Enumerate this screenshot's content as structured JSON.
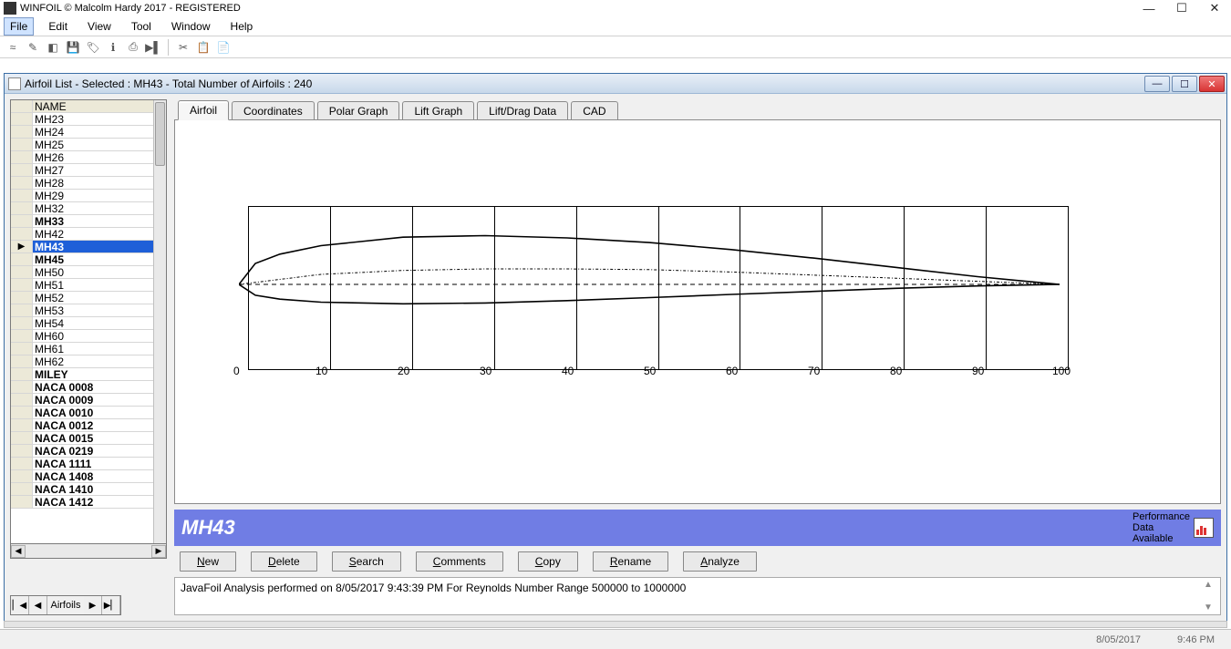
{
  "titlebar": {
    "text": "WINFOIL © Malcolm Hardy 2017 - REGISTERED"
  },
  "window_controls": {
    "min": "—",
    "max": "☐",
    "close": "✕"
  },
  "menu": [
    "File",
    "Edit",
    "View",
    "Tool",
    "Window",
    "Help"
  ],
  "menu_active_idx": 0,
  "toolbar_icons": [
    "≈",
    "✎",
    "◧",
    "💾",
    "🏷",
    "ℹ",
    "⎙",
    "▶▌",
    "│",
    "✂",
    "📋",
    "📄"
  ],
  "subwindow": {
    "title": "Airfoil List - Selected : MH43 - Total Number of Airfoils : 240",
    "min": "—",
    "max": "☐",
    "close": "✕"
  },
  "list": {
    "header": "NAME",
    "items": [
      {
        "n": "MH23",
        "b": false
      },
      {
        "n": "MH24",
        "b": false
      },
      {
        "n": "MH25",
        "b": false
      },
      {
        "n": "MH26",
        "b": false
      },
      {
        "n": "MH27",
        "b": false
      },
      {
        "n": "MH28",
        "b": false
      },
      {
        "n": "MH29",
        "b": false
      },
      {
        "n": "MH32",
        "b": false
      },
      {
        "n": "MH33",
        "b": true
      },
      {
        "n": "MH42",
        "b": false
      },
      {
        "n": "MH43",
        "b": true,
        "sel": true
      },
      {
        "n": "MH45",
        "b": true
      },
      {
        "n": "MH50",
        "b": false
      },
      {
        "n": "MH51",
        "b": false
      },
      {
        "n": "MH52",
        "b": false
      },
      {
        "n": "MH53",
        "b": false
      },
      {
        "n": "MH54",
        "b": false
      },
      {
        "n": "MH60",
        "b": false
      },
      {
        "n": "MH61",
        "b": false
      },
      {
        "n": "MH62",
        "b": false
      },
      {
        "n": "MILEY",
        "b": true
      },
      {
        "n": "NACA 0008",
        "b": true
      },
      {
        "n": "NACA 0009",
        "b": true
      },
      {
        "n": "NACA 0010",
        "b": true
      },
      {
        "n": "NACA 0012",
        "b": true
      },
      {
        "n": "NACA 0015",
        "b": true
      },
      {
        "n": "NACA 0219",
        "b": true
      },
      {
        "n": "NACA 1111",
        "b": true
      },
      {
        "n": "NACA 1408",
        "b": true
      },
      {
        "n": "NACA 1410",
        "b": true
      },
      {
        "n": "NACA 1412",
        "b": true
      }
    ]
  },
  "nav": {
    "label": "Airfoils",
    "first": "▏◀",
    "prev": "◀",
    "next": "▶",
    "last": "▶▏"
  },
  "tabs": [
    "Airfoil",
    "Coordinates",
    "Polar Graph",
    "Lift Graph",
    "Lift/Drag Data",
    "CAD"
  ],
  "tabs_active": 0,
  "chart_data": {
    "type": "line",
    "title": "",
    "xlabel": "",
    "ylabel": "",
    "xlim": [
      0,
      100
    ],
    "xticks": [
      0,
      10,
      20,
      30,
      40,
      50,
      60,
      70,
      80,
      90,
      100
    ],
    "series": [
      {
        "name": "upper_surface",
        "style": "solid",
        "x": [
          0,
          2,
          5,
          10,
          20,
          30,
          40,
          50,
          60,
          70,
          80,
          90,
          95,
          100
        ],
        "y": [
          0,
          2.7,
          3.9,
          5.0,
          6.1,
          6.3,
          6.0,
          5.4,
          4.5,
          3.4,
          2.2,
          1.0,
          0.5,
          0
        ]
      },
      {
        "name": "lower_surface",
        "style": "solid",
        "x": [
          0,
          2,
          5,
          10,
          20,
          30,
          40,
          50,
          60,
          70,
          80,
          90,
          95,
          100
        ],
        "y": [
          0,
          -1.4,
          -1.9,
          -2.3,
          -2.5,
          -2.4,
          -2.1,
          -1.7,
          -1.3,
          -0.9,
          -0.5,
          -0.2,
          -0.1,
          0
        ]
      },
      {
        "name": "camber_line",
        "style": "dashdot",
        "x": [
          0,
          10,
          20,
          30,
          40,
          50,
          60,
          70,
          80,
          90,
          100
        ],
        "y": [
          0,
          1.3,
          1.8,
          2.0,
          2.0,
          1.9,
          1.6,
          1.2,
          0.8,
          0.4,
          0
        ]
      },
      {
        "name": "chord_line",
        "style": "dashed",
        "x": [
          0,
          100
        ],
        "y": [
          0,
          0
        ]
      }
    ]
  },
  "banner": {
    "title": "MH43",
    "perf": "Performance\nData\nAvailable"
  },
  "buttons": [
    "New",
    "Delete",
    "Search",
    "Comments",
    "Copy",
    "Rename",
    "Analyze"
  ],
  "status": "JavaFoil Analysis performed on 8/05/2017 9:43:39 PM  For Reynolds Number Range 500000 to 1000000",
  "osbar": {
    "date": "8/05/2017",
    "time": "9:46 PM"
  }
}
